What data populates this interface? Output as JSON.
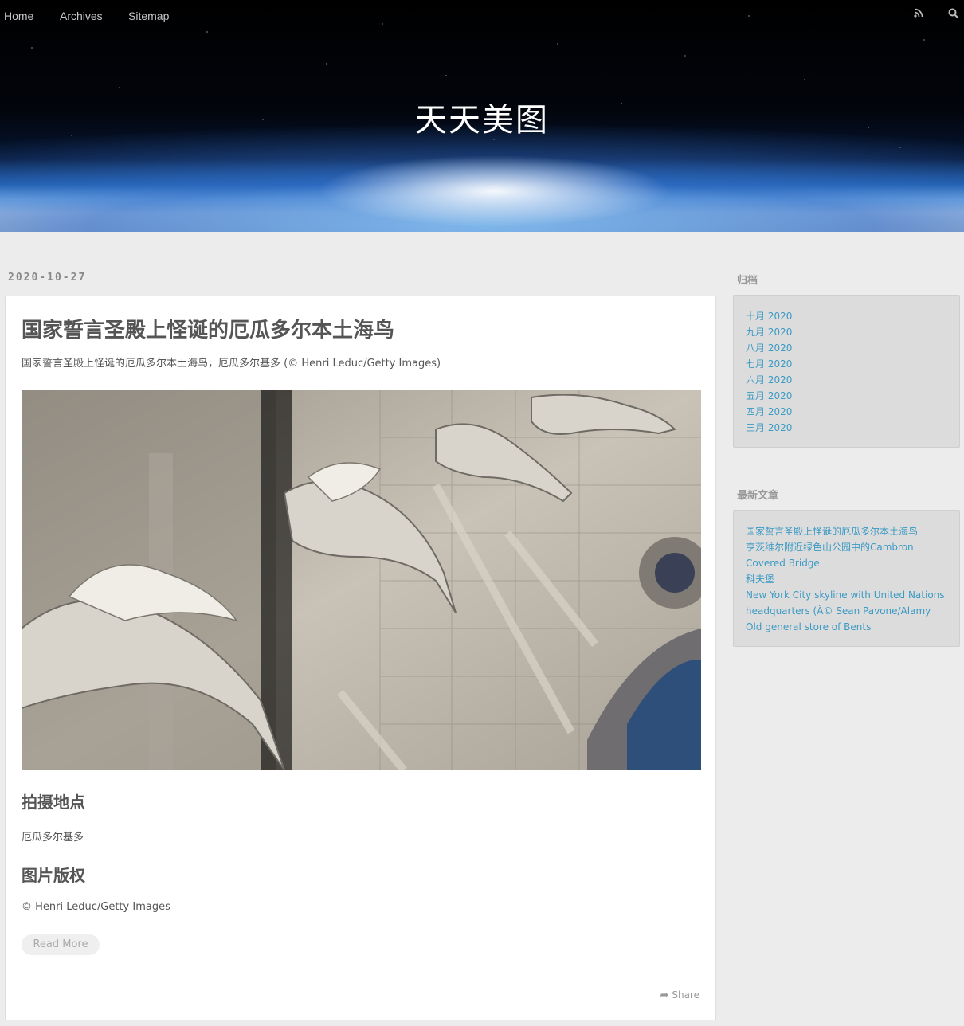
{
  "nav": {
    "home": "Home",
    "archives": "Archives",
    "sitemap": "Sitemap",
    "rss_icon": "rss-icon",
    "search_icon": "search-icon"
  },
  "site_title": "天天美图",
  "post": {
    "date": "2020-10-27",
    "title": "国家誓言圣殿上怪诞的厄瓜多尔本土海鸟",
    "excerpt": "国家誓言圣殿上怪诞的厄瓜多尔本土海鸟，厄瓜多尔基多 (© Henri Leduc/Getty Images)",
    "location_heading": "拍摄地点",
    "location": "厄瓜多尔基多",
    "copyright_heading": "图片版权",
    "copyright": "© Henri Leduc/Getty Images",
    "read_more": "Read More",
    "share": "Share"
  },
  "sidebar": {
    "archive_title": "归档",
    "archives": [
      "十月 2020",
      "九月 2020",
      "八月 2020",
      "七月 2020",
      "六月 2020",
      "五月 2020",
      "四月 2020",
      "三月 2020"
    ],
    "recent_title": "最新文章",
    "recent": [
      "国家誓言圣殿上怪诞的厄瓜多尔本土海鸟",
      "亨茨维尔附近绿色山公园中的Cambron Covered Bridge",
      "科夫堡",
      "New York City skyline with United Nations headquarters (Â© Sean Pavone/Alamy",
      "Old general store of Bents"
    ]
  },
  "colors": {
    "link": "#3b9ac4",
    "background": "#ececec",
    "widget_bg": "#dcdcdc"
  }
}
